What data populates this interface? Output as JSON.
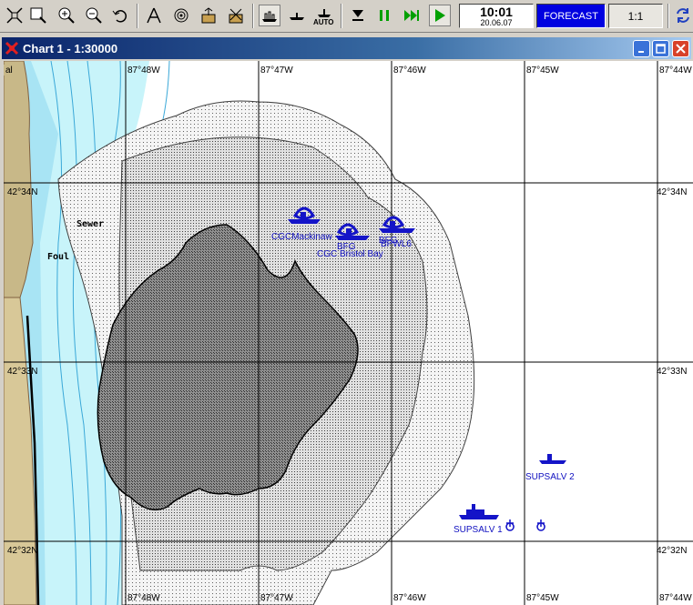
{
  "toolbar": {
    "buttons": [
      "fullscreen-icon",
      "zoom-window-icon",
      "zoom-in-icon",
      "zoom-out-icon",
      "undo-icon",
      "route-icon",
      "target-icon",
      "export-icon",
      "import-icon",
      "ship-mode-icon",
      "ship-icon",
      "auto-icon",
      "stop-icon",
      "pause-icon",
      "fast-forward-icon",
      "play-icon",
      "refresh-icon"
    ],
    "auto_label": "AUTO",
    "time": "10:01",
    "date": "20.06.07",
    "forecast_label": "FORECAST",
    "scale_label": "1:1"
  },
  "window": {
    "title": "Chart 1 - 1:30000"
  },
  "map": {
    "lon_labels_top": [
      "87°48W",
      "87°47W",
      "87°46W",
      "87°45W",
      "87°44W"
    ],
    "lon_labels_bottom": [
      "87°48W",
      "87°47W",
      "87°46W",
      "87°45W",
      "87°44W"
    ],
    "lat_labels_left": [
      "42°34N",
      "42°33N",
      "42°32N"
    ],
    "lat_labels_right": [
      "42°34N",
      "42°33N",
      "42°32N"
    ],
    "top_left_label": "al",
    "shore_labels": [
      "Sewer",
      "Foul"
    ],
    "vessels": [
      {
        "name": "CGC Mackinaw",
        "label": "CGCMackinaw"
      },
      {
        "name": "CGC Bristol Bay",
        "label": "CGC Bristol Bay"
      },
      {
        "name": "BFG",
        "label": "BFG"
      },
      {
        "name": "BFG",
        "label": "BFG"
      },
      {
        "name": "BPWL",
        "label": "BPWL6"
      },
      {
        "name": "SUPSALV 2",
        "label": "SUPSALV 2"
      },
      {
        "name": "SUPSALV 1",
        "label": "SUPSALV 1"
      }
    ]
  },
  "colors": {
    "land": "#c8b888",
    "shallow_water": "#bff0f8",
    "deep_blue_line": "#3aa8d8",
    "oil_dark": "#888888",
    "oil_light": "#d8d8d8",
    "vessel": "#1414c8",
    "forecast_bg": "#0000e0"
  }
}
